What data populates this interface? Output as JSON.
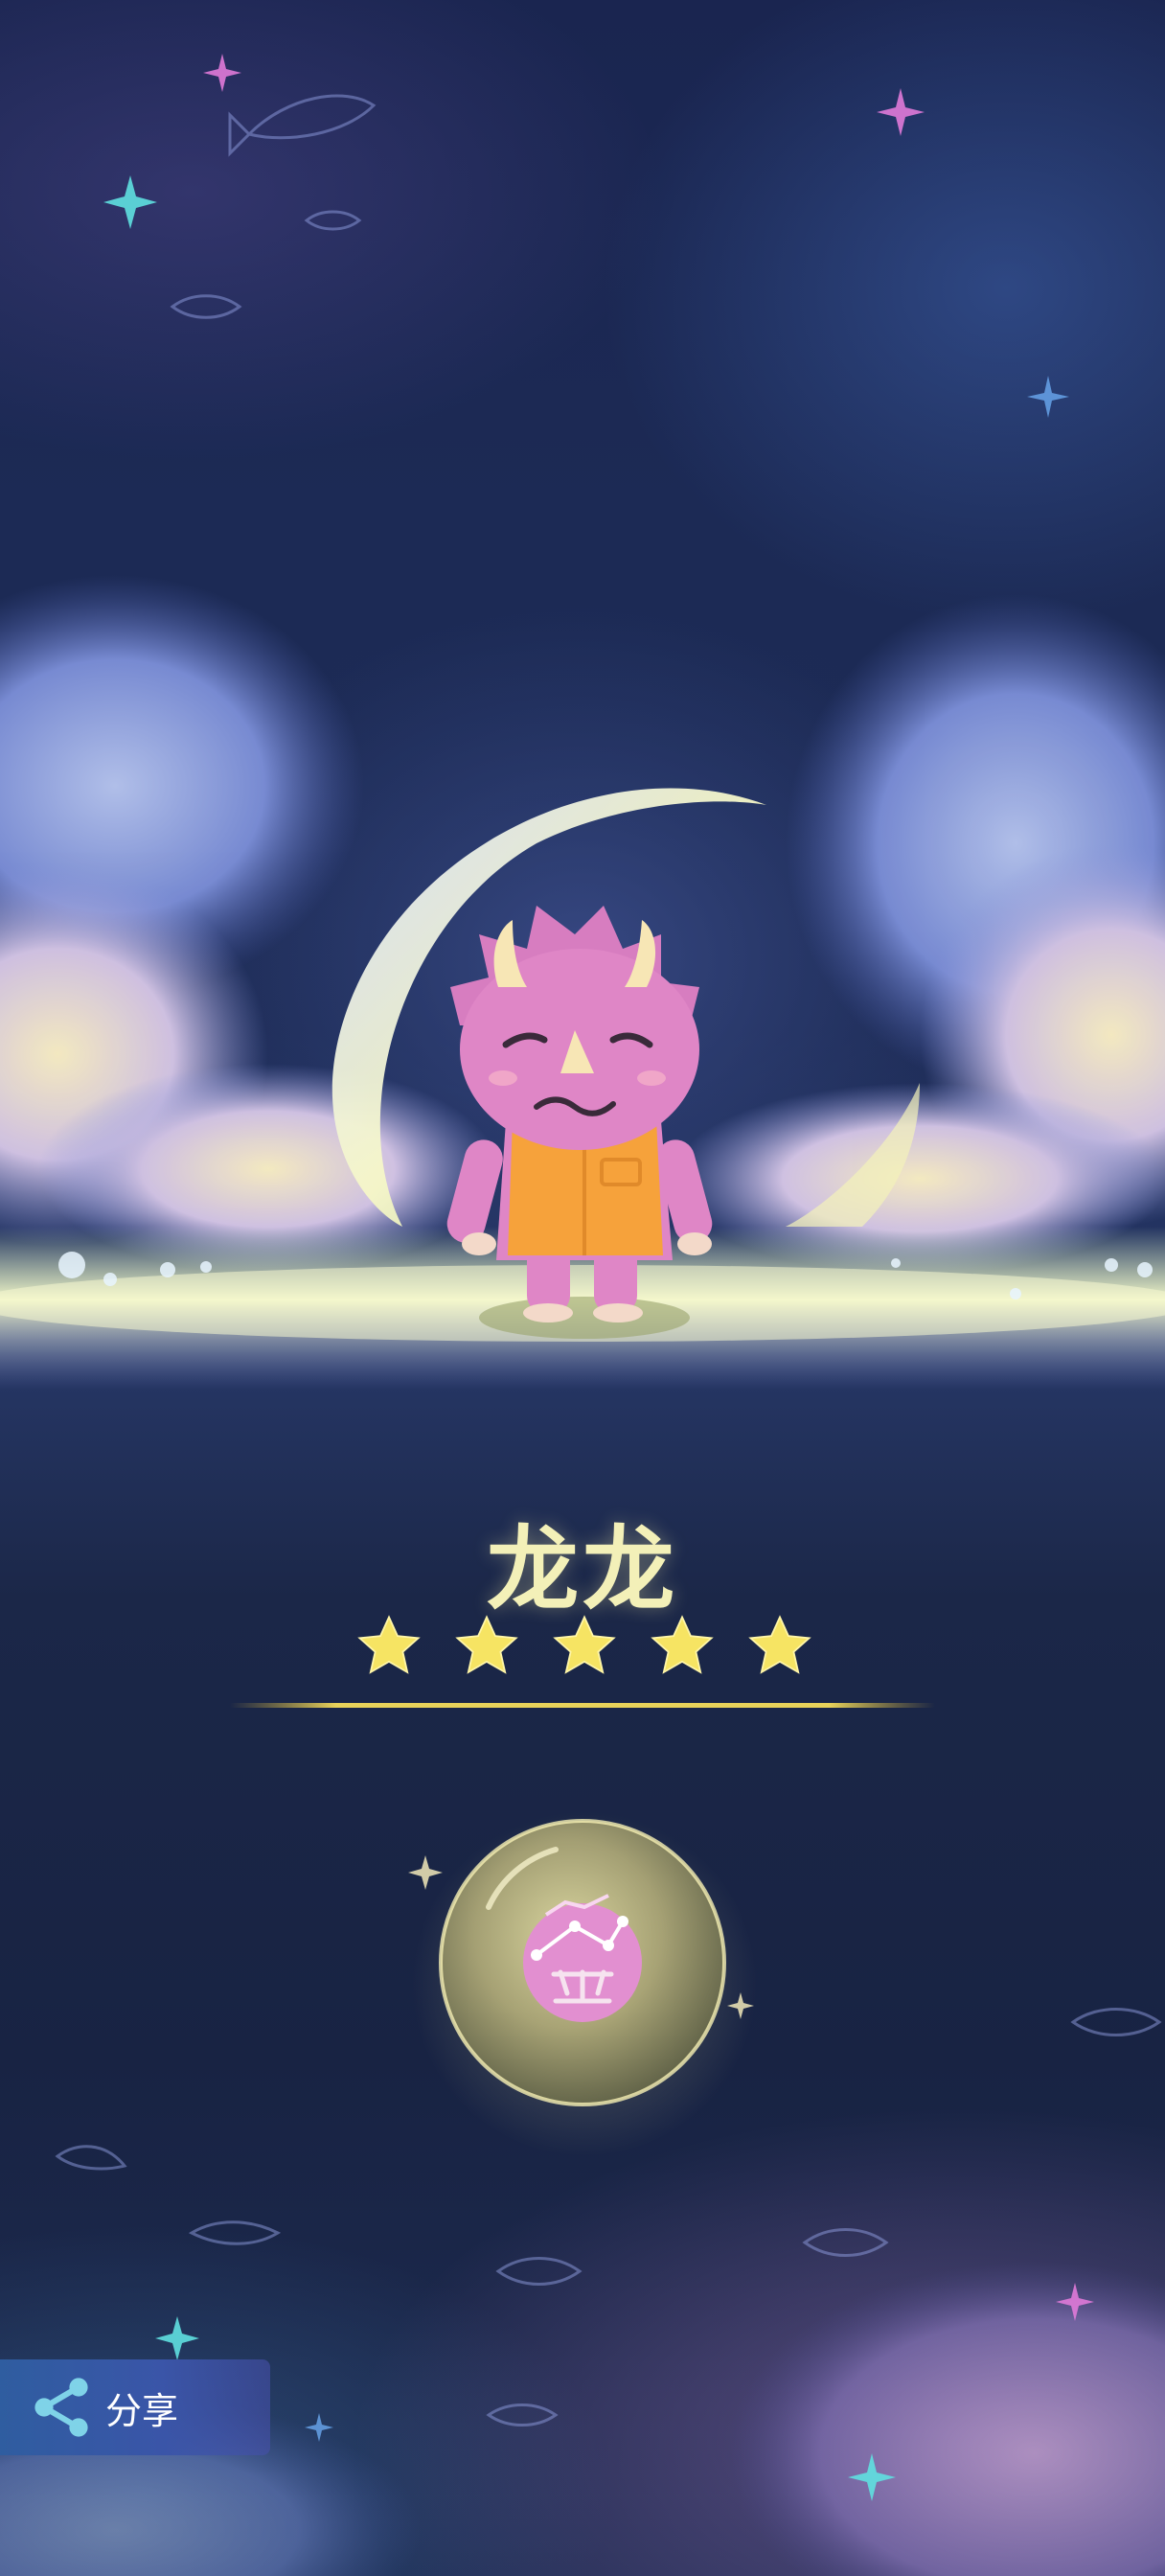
{
  "character": {
    "name": "龙龙",
    "stars": 5
  },
  "share": {
    "label": "分享",
    "icon": "share-icon"
  },
  "zodiac_badge": {
    "icon": "sagittarius-constellation-icon"
  },
  "colors": {
    "title": "#f3f0b8",
    "star": "#f6e463",
    "background": "#1c2a55",
    "share_button": "#3a55a8"
  }
}
